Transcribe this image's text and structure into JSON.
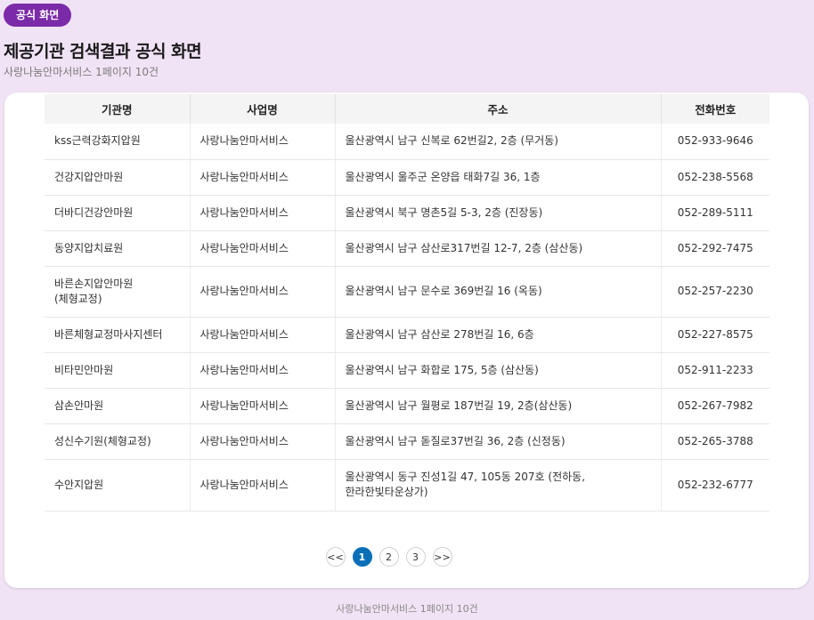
{
  "badge": "공식 화면",
  "title": "제공기관 검색결과 공식 화면",
  "subtitle": "사랑나눔안마서비스 1페이지 10건",
  "table": {
    "headers": [
      "기관명",
      "사업명",
      "주소",
      "전화번호"
    ],
    "rows": [
      {
        "name": "kss근력강화지압원",
        "service": "사랑나눔안마서비스",
        "address": "울산광역시 남구 신복로 62번길2, 2층 (무거동)",
        "phone": "052-933-9646"
      },
      {
        "name": "건강지압안마원",
        "service": "사랑나눔안마서비스",
        "address": "울산광역시 울주군 온양읍 태화7길 36, 1층",
        "phone": "052-238-5568"
      },
      {
        "name": "더바디건강안마원",
        "service": "사랑나눔안마서비스",
        "address": "울산광역시 북구 명촌5길 5-3, 2층 (진장동)",
        "phone": "052-289-5111"
      },
      {
        "name": "동양지압치료원",
        "service": "사랑나눔안마서비스",
        "address": "울산광역시 남구 삼산로317번길 12-7, 2층 (삼산동)",
        "phone": "052-292-7475"
      },
      {
        "name": "바른손지압안마원\n(체형교정)",
        "service": "사랑나눔안마서비스",
        "address": "울산광역시 남구 문수로 369번길 16 (옥동)",
        "phone": "052-257-2230"
      },
      {
        "name": "바른체형교정마사지센터",
        "service": "사랑나눔안마서비스",
        "address": "울산광역시 남구 삼산로 278번길 16, 6층",
        "phone": "052-227-8575"
      },
      {
        "name": "비타민안마원",
        "service": "사랑나눔안마서비스",
        "address": "울산광역시 남구 화합로 175, 5층 (삼산동)",
        "phone": "052-911-2233"
      },
      {
        "name": "삼손안마원",
        "service": "사랑나눔안마서비스",
        "address": "울산광역시 남구 월평로 187번길 19, 2층(삼산동)",
        "phone": "052-267-7982"
      },
      {
        "name": "성신수기원(체형교정)",
        "service": "사랑나눔안마서비스",
        "address": "울산광역시 남구 돋질로37번길 36, 2층 (신정동)",
        "phone": "052-265-3788"
      },
      {
        "name": "수안지압원",
        "service": "사랑나눔안마서비스",
        "address": "울산광역시 동구 진성1길 47, 105동 207호 (전하동,\n한라한빛타운상가)",
        "phone": "052-232-6777"
      }
    ]
  },
  "pagination": {
    "first": "<<",
    "pages": [
      "1",
      "2",
      "3"
    ],
    "current": "1",
    "last": ">>"
  },
  "footer": "사랑나눔안마서비스 1페이지 10건",
  "colors": {
    "background": "#f1e3f6",
    "badge": "#7b2aa8",
    "active_page": "#0b6fb8"
  }
}
